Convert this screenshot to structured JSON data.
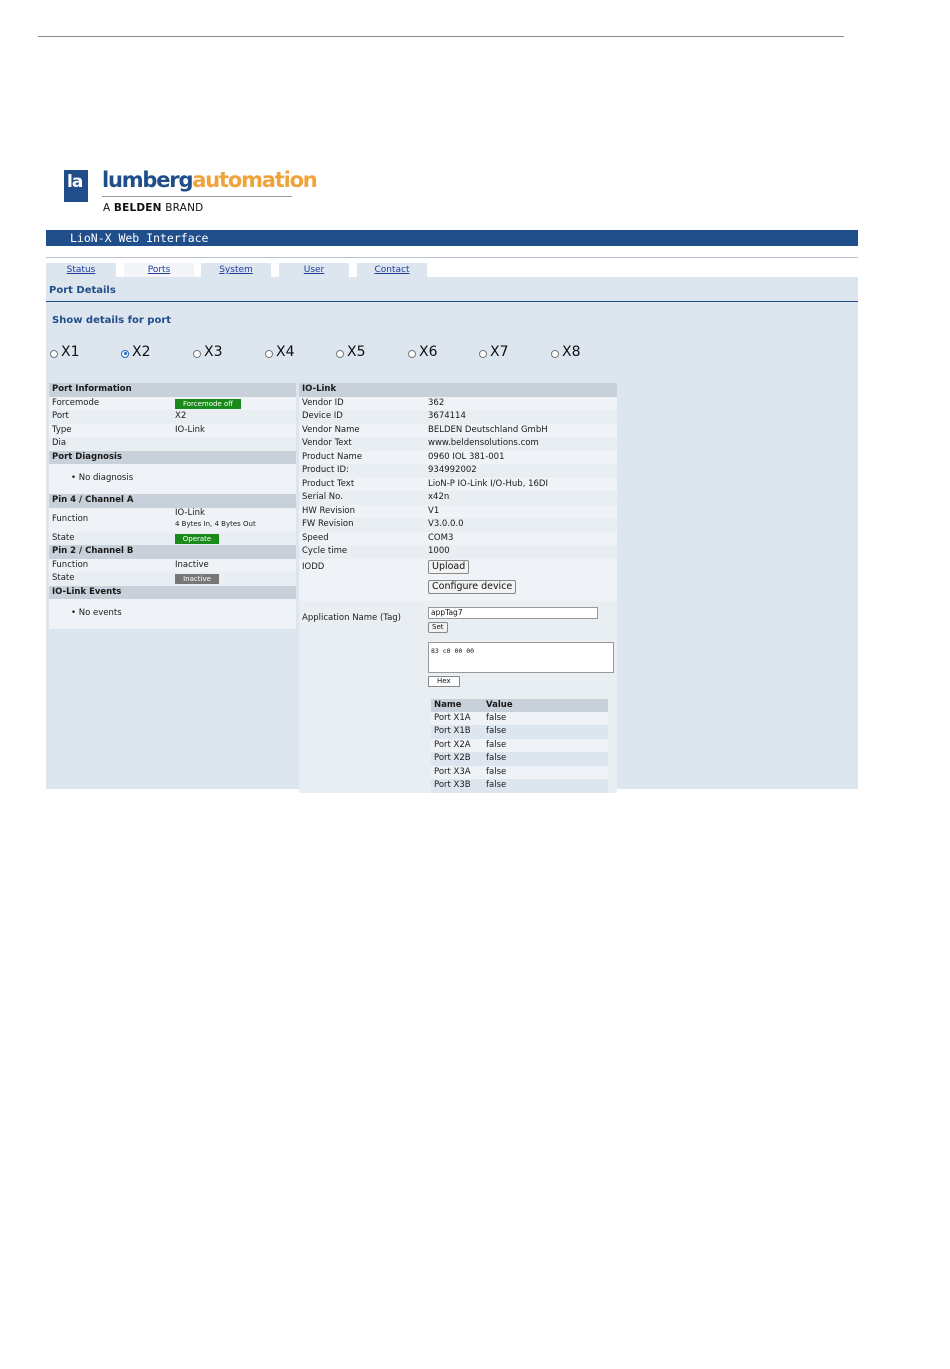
{
  "brand": {
    "logo_mark": "la",
    "word_blue": "lumberg",
    "word_orange": "automation",
    "tagline_prefix": "A ",
    "tagline_bold": "BELDEN",
    "tagline_suffix": " BRAND"
  },
  "app": {
    "title": "LioN-X Web Interface",
    "tabs": [
      {
        "label": "Status"
      },
      {
        "label": "Ports"
      },
      {
        "label": "System"
      },
      {
        "label": "User"
      },
      {
        "label": "Contact"
      }
    ],
    "active_tab": "Ports",
    "section_title": "Port Details",
    "show_for_label": "Show details for port",
    "ports": [
      "X1",
      "X2",
      "X3",
      "X4",
      "X5",
      "X6",
      "X7",
      "X8"
    ],
    "selected_port": "X2"
  },
  "port_info": {
    "header": "Port Information",
    "forcemode_label": "Forcemode",
    "forcemode_badge": "Forcemode off",
    "port_label": "Port",
    "port_value": "X2",
    "type_label": "Type",
    "type_value": "IO-Link",
    "dia_label": "Dia"
  },
  "port_diagnosis": {
    "header": "Port Diagnosis",
    "item": "No diagnosis"
  },
  "pin4": {
    "header": "Pin 4 / Channel A",
    "function_label": "Function",
    "function_value": "IO-Link",
    "function_sub": "4 Bytes In, 4 Bytes Out",
    "state_label": "State",
    "state_badge": "Operate"
  },
  "pin2": {
    "header": "Pin 2 / Channel B",
    "function_label": "Function",
    "function_value": "Inactive",
    "state_label": "State",
    "state_badge": "Inactive"
  },
  "iolink_events": {
    "header": "IO-Link Events",
    "item": "No events"
  },
  "iolink": {
    "header": "IO-Link",
    "rows": [
      {
        "k": "Vendor ID",
        "v": "362"
      },
      {
        "k": "Device ID",
        "v": "3674114"
      },
      {
        "k": "Vendor Name",
        "v": "BELDEN Deutschland GmbH"
      },
      {
        "k": "Vendor Text",
        "v": "www.beldensolutions.com"
      },
      {
        "k": "Product Name",
        "v": "0960 IOL 381-001"
      },
      {
        "k": "Product ID:",
        "v": "934992002"
      },
      {
        "k": "Product Text",
        "v": "LioN-P IO-Link I/O-Hub, 16DI"
      },
      {
        "k": "Serial No.",
        "v": "x42n"
      },
      {
        "k": "HW Revision",
        "v": "V1"
      },
      {
        "k": "FW Revision",
        "v": "V3.0.0.0"
      },
      {
        "k": "Speed",
        "v": "COM3"
      },
      {
        "k": "Cycle time",
        "v": "1000"
      }
    ],
    "iodd_label": "IODD",
    "upload_button": "Upload",
    "configure_button": "Configure device",
    "app_name_label": "Application Name (Tag)",
    "app_name_value": "appTag7",
    "set_button": "Set",
    "hex_value": "83 c0 00 00",
    "hex_button": "Hex",
    "data_table": {
      "headers": [
        "Name",
        "Value"
      ],
      "rows": [
        [
          "Port X1A",
          "false"
        ],
        [
          "Port X1B",
          "false"
        ],
        [
          "Port X2A",
          "false"
        ],
        [
          "Port X2B",
          "false"
        ],
        [
          "Port X3A",
          "false"
        ],
        [
          "Port X3B",
          "false"
        ]
      ]
    }
  },
  "colors": {
    "brand_blue": "#1f4e8a",
    "brand_orange": "#f0a33a",
    "status_green": "#1a8a1a",
    "status_grey": "#777777"
  }
}
